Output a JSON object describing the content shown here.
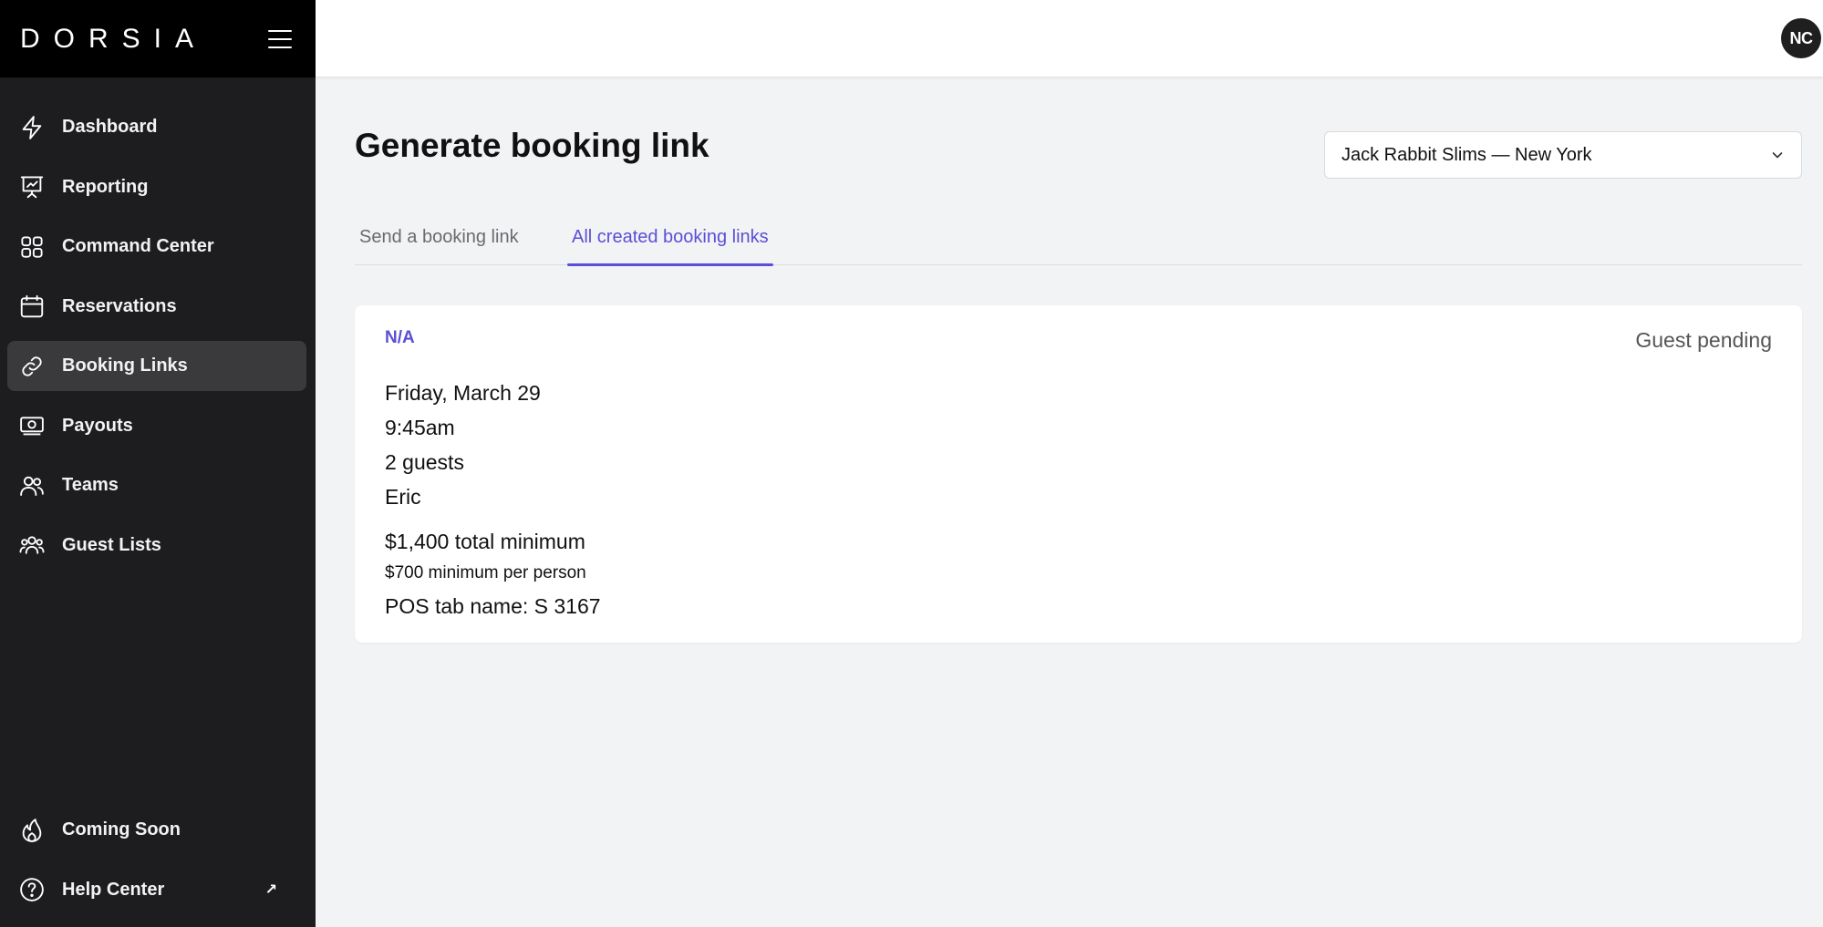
{
  "brand": {
    "logo": "DORSIA"
  },
  "sidebar": {
    "items": [
      {
        "label": "Dashboard",
        "icon": "lightning-icon"
      },
      {
        "label": "Reporting",
        "icon": "presentation-chart-icon"
      },
      {
        "label": "Command Center",
        "icon": "grid-icon"
      },
      {
        "label": "Reservations",
        "icon": "calendar-icon"
      },
      {
        "label": "Booking Links",
        "icon": "link-icon",
        "active": true
      },
      {
        "label": "Payouts",
        "icon": "cash-icon"
      },
      {
        "label": "Teams",
        "icon": "users-icon"
      },
      {
        "label": "Guest Lists",
        "icon": "user-group-icon"
      }
    ],
    "bottom_items": [
      {
        "label": "Coming Soon",
        "icon": "fire-icon"
      },
      {
        "label": "Help Center",
        "icon": "question-circle-icon",
        "external": "↗"
      }
    ]
  },
  "header": {
    "avatar_initials": "NC"
  },
  "main": {
    "title": "Generate booking link",
    "venue_select": {
      "value": "Jack Rabbit Slims — New York"
    },
    "tabs": [
      {
        "label": "Send a booking link",
        "active": false
      },
      {
        "label": "All created booking links",
        "active": true
      }
    ],
    "booking": {
      "code": "N/A",
      "status": "Guest pending",
      "date": "Friday, March 29",
      "time": "9:45am",
      "guests": "2 guests",
      "name": "Eric",
      "total_minimum": "$1,400 total minimum",
      "per_person": "$700 minimum per person",
      "pos_tab": "POS tab name: S 3167"
    }
  },
  "colors": {
    "accent": "#5b4fd6",
    "sidebar_bg": "#1d1d1f",
    "header_bg": "#000000",
    "page_bg": "#f2f3f5"
  }
}
